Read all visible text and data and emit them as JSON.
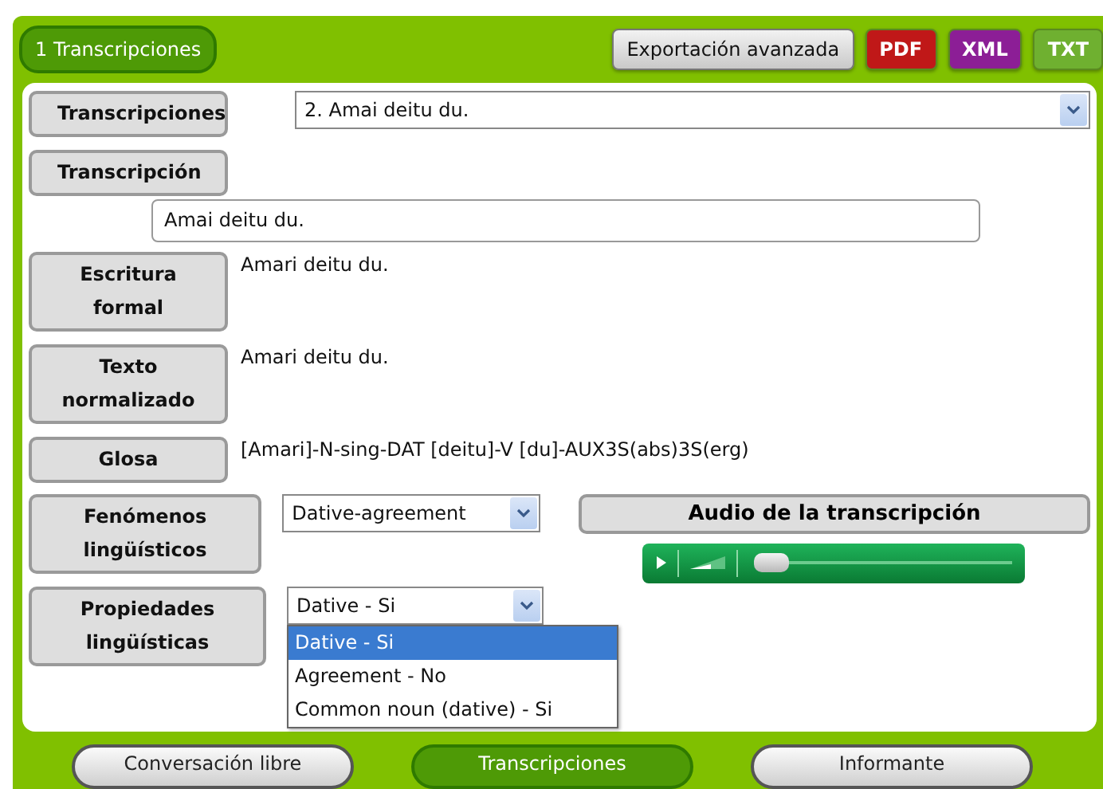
{
  "header_tab": {
    "label": "1 Transcripciones"
  },
  "export_buttons": [
    {
      "label": "Exportación avanzada",
      "kind": "advanced"
    },
    {
      "label": "PDF",
      "kind": "pdf"
    },
    {
      "label": "XML",
      "kind": "xml"
    },
    {
      "label": "TXT",
      "kind": "txt"
    }
  ],
  "transcriptions": {
    "label": "Transcripciones",
    "value": "2. Amai deitu du."
  },
  "transcription": {
    "label": "Transcripción",
    "value": "Amai deitu du."
  },
  "formal_writing": {
    "label": "Escritura formal",
    "text": "Amari deitu du."
  },
  "normalized_text": {
    "label": "Texto normalizado",
    "text": "Amari deitu du."
  },
  "gloss": {
    "label": "Glosa",
    "text": "[Amari]-N-sing-DAT [deitu]-V [du]-AUX3S(abs)3S(erg)"
  },
  "phenomena": {
    "label": "Fenómenos lingüísticos",
    "value": "Dative-agreement"
  },
  "audio": {
    "label": "Audio de la transcripción",
    "level": 0.0
  },
  "properties": {
    "label": "Propiedades lingüísticas",
    "value": "Dative - Si",
    "expanded": true,
    "options": [
      {
        "label": "Dative - Si",
        "selected": true
      },
      {
        "label": "Agreement - No",
        "selected": false
      },
      {
        "label": "Common noun (dative) - Si",
        "selected": false
      }
    ]
  },
  "bottom_tabs": [
    {
      "label": "Conversación libre",
      "selected": false
    },
    {
      "label": "Transcripciones",
      "selected": true
    },
    {
      "label": "Informante",
      "selected": false
    }
  ]
}
